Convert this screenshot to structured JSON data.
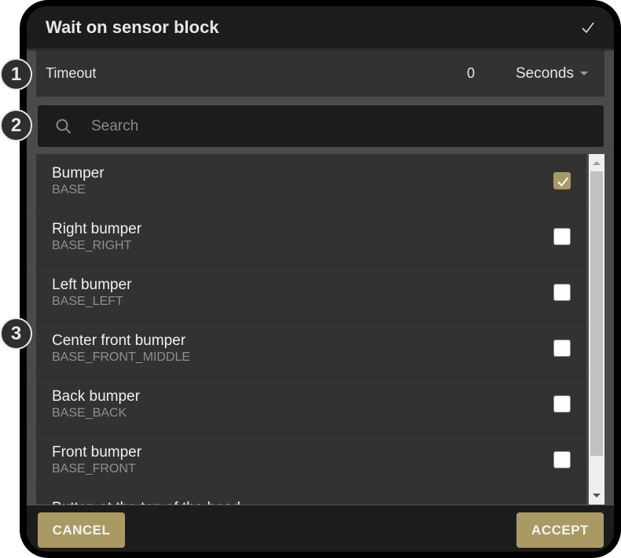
{
  "dialog": {
    "title": "Wait on sensor block",
    "confirm_icon": "check-icon"
  },
  "timeout": {
    "label": "Timeout",
    "value": "0",
    "unit": "Seconds"
  },
  "search": {
    "placeholder": "Search",
    "value": ""
  },
  "sensors": [
    {
      "name": "Bumper",
      "id": "BASE",
      "checked": true
    },
    {
      "name": "Right bumper",
      "id": "BASE_RIGHT",
      "checked": false
    },
    {
      "name": "Left bumper",
      "id": "BASE_LEFT",
      "checked": false
    },
    {
      "name": "Center front bumper",
      "id": "BASE_FRONT_MIDDLE",
      "checked": false
    },
    {
      "name": "Back bumper",
      "id": "BASE_BACK",
      "checked": false
    },
    {
      "name": "Front bumper",
      "id": "BASE_FRONT",
      "checked": false
    },
    {
      "name": "Button at the top of the head",
      "id": "",
      "checked": false
    }
  ],
  "footer": {
    "cancel_label": "CANCEL",
    "accept_label": "ACCEPT"
  },
  "annotations": [
    "1",
    "2",
    "3"
  ],
  "colors": {
    "accent": "#a99a63",
    "background": "#1c1c1c",
    "panel": "#323232"
  }
}
